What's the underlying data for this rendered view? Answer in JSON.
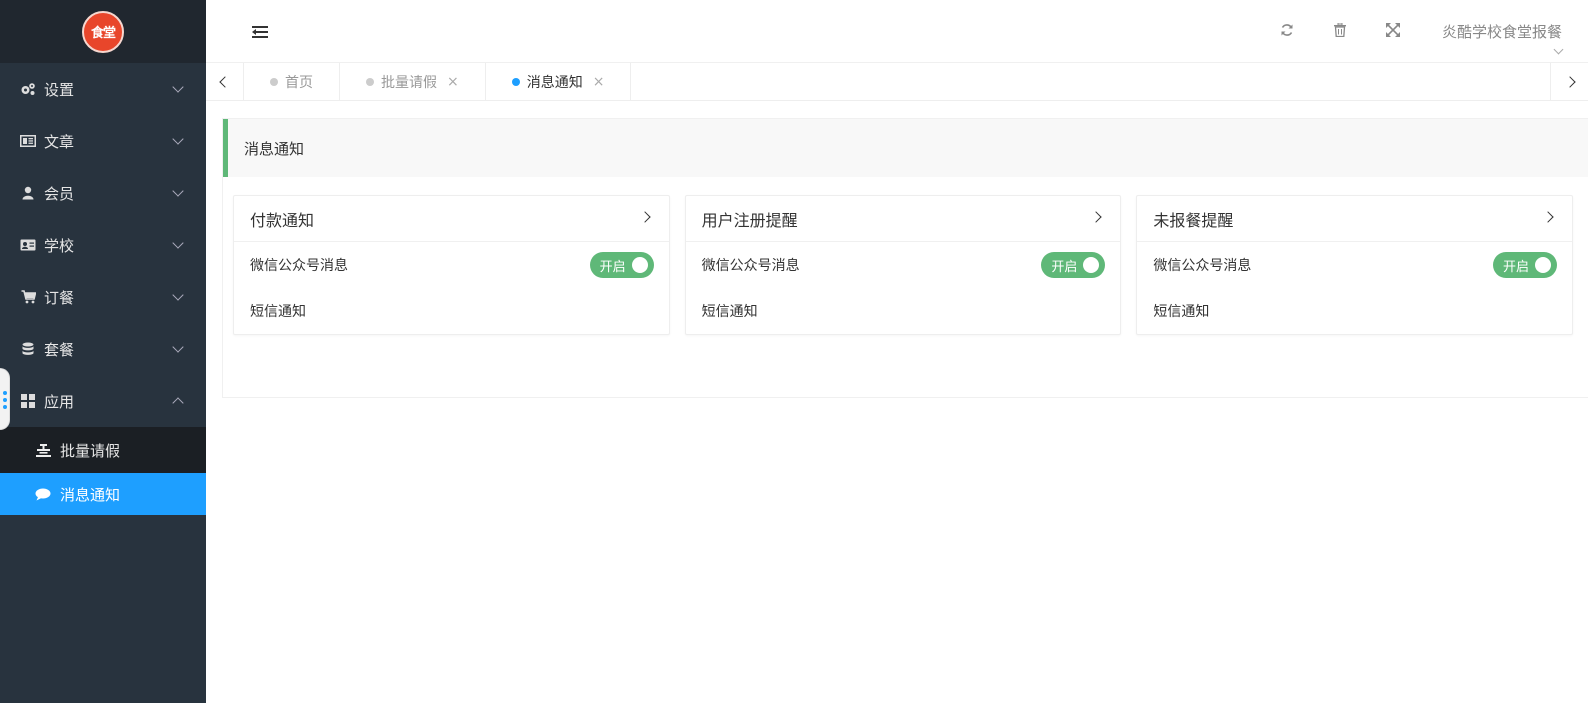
{
  "logo": {
    "text": "食堂"
  },
  "sidebar": {
    "items": [
      {
        "label": "设置",
        "icon": "gears-icon"
      },
      {
        "label": "文章",
        "icon": "newspaper-icon"
      },
      {
        "label": "会员",
        "icon": "user-icon"
      },
      {
        "label": "学校",
        "icon": "id-card-icon"
      },
      {
        "label": "订餐",
        "icon": "cart-icon"
      },
      {
        "label": "套餐",
        "icon": "database-icon"
      },
      {
        "label": "应用",
        "icon": "grid-icon"
      }
    ],
    "sub_items": [
      {
        "label": "批量请假",
        "icon": "leave-icon"
      },
      {
        "label": "消息通知",
        "icon": "comment-icon"
      }
    ]
  },
  "header": {
    "user_name": "炎酷学校食堂报餐"
  },
  "tabs": [
    {
      "label": "首页"
    },
    {
      "label": "批量请假",
      "close": "×"
    },
    {
      "label": "消息通知",
      "close": "×"
    }
  ],
  "page": {
    "title": "消息通知"
  },
  "cards": [
    {
      "title": "付款通知",
      "row1": "微信公众号消息",
      "toggle": "开启",
      "row2": "短信通知"
    },
    {
      "title": "用户注册提醒",
      "row1": "微信公众号消息",
      "toggle": "开启",
      "row2": "短信通知"
    },
    {
      "title": "未报餐提醒",
      "row1": "微信公众号消息",
      "toggle": "开启",
      "row2": "短信通知"
    }
  ],
  "colors": {
    "sidebar_bg": "#28333e",
    "active_blue": "#1e9fff",
    "toggle_green": "#5fb878",
    "logo_red": "#e8462b"
  }
}
